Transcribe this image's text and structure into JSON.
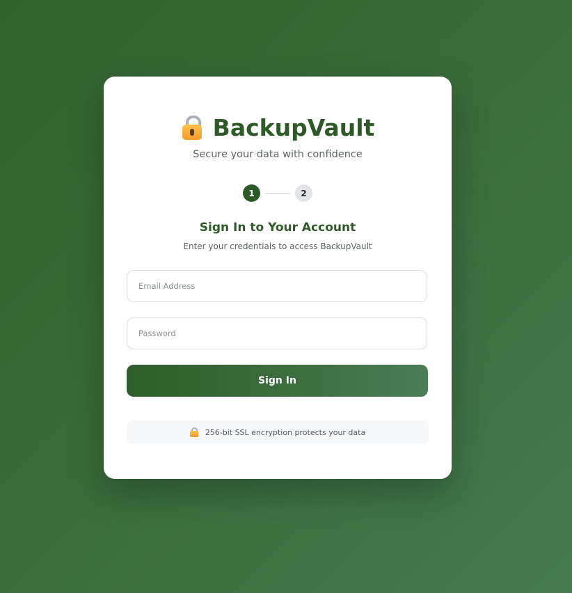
{
  "brand": {
    "icon": "lock-icon",
    "title": "BackupVault",
    "tagline": "Secure your data with confidence"
  },
  "steps": {
    "items": [
      "1",
      "2"
    ],
    "current": 1
  },
  "form": {
    "title": "Sign In to Your Account",
    "subtitle": "Enter your credentials to access BackupVault",
    "email": {
      "placeholder": "Email Address",
      "value": ""
    },
    "password": {
      "placeholder": "Password",
      "value": ""
    },
    "submit_label": "Sign In"
  },
  "security_note": {
    "icon": "lock-icon",
    "text": "256-bit SSL encryption protects your data"
  },
  "colors": {
    "brand_green": "#2d5a27",
    "background": "#3b6b3b",
    "note_background": "#f6f7f9"
  }
}
